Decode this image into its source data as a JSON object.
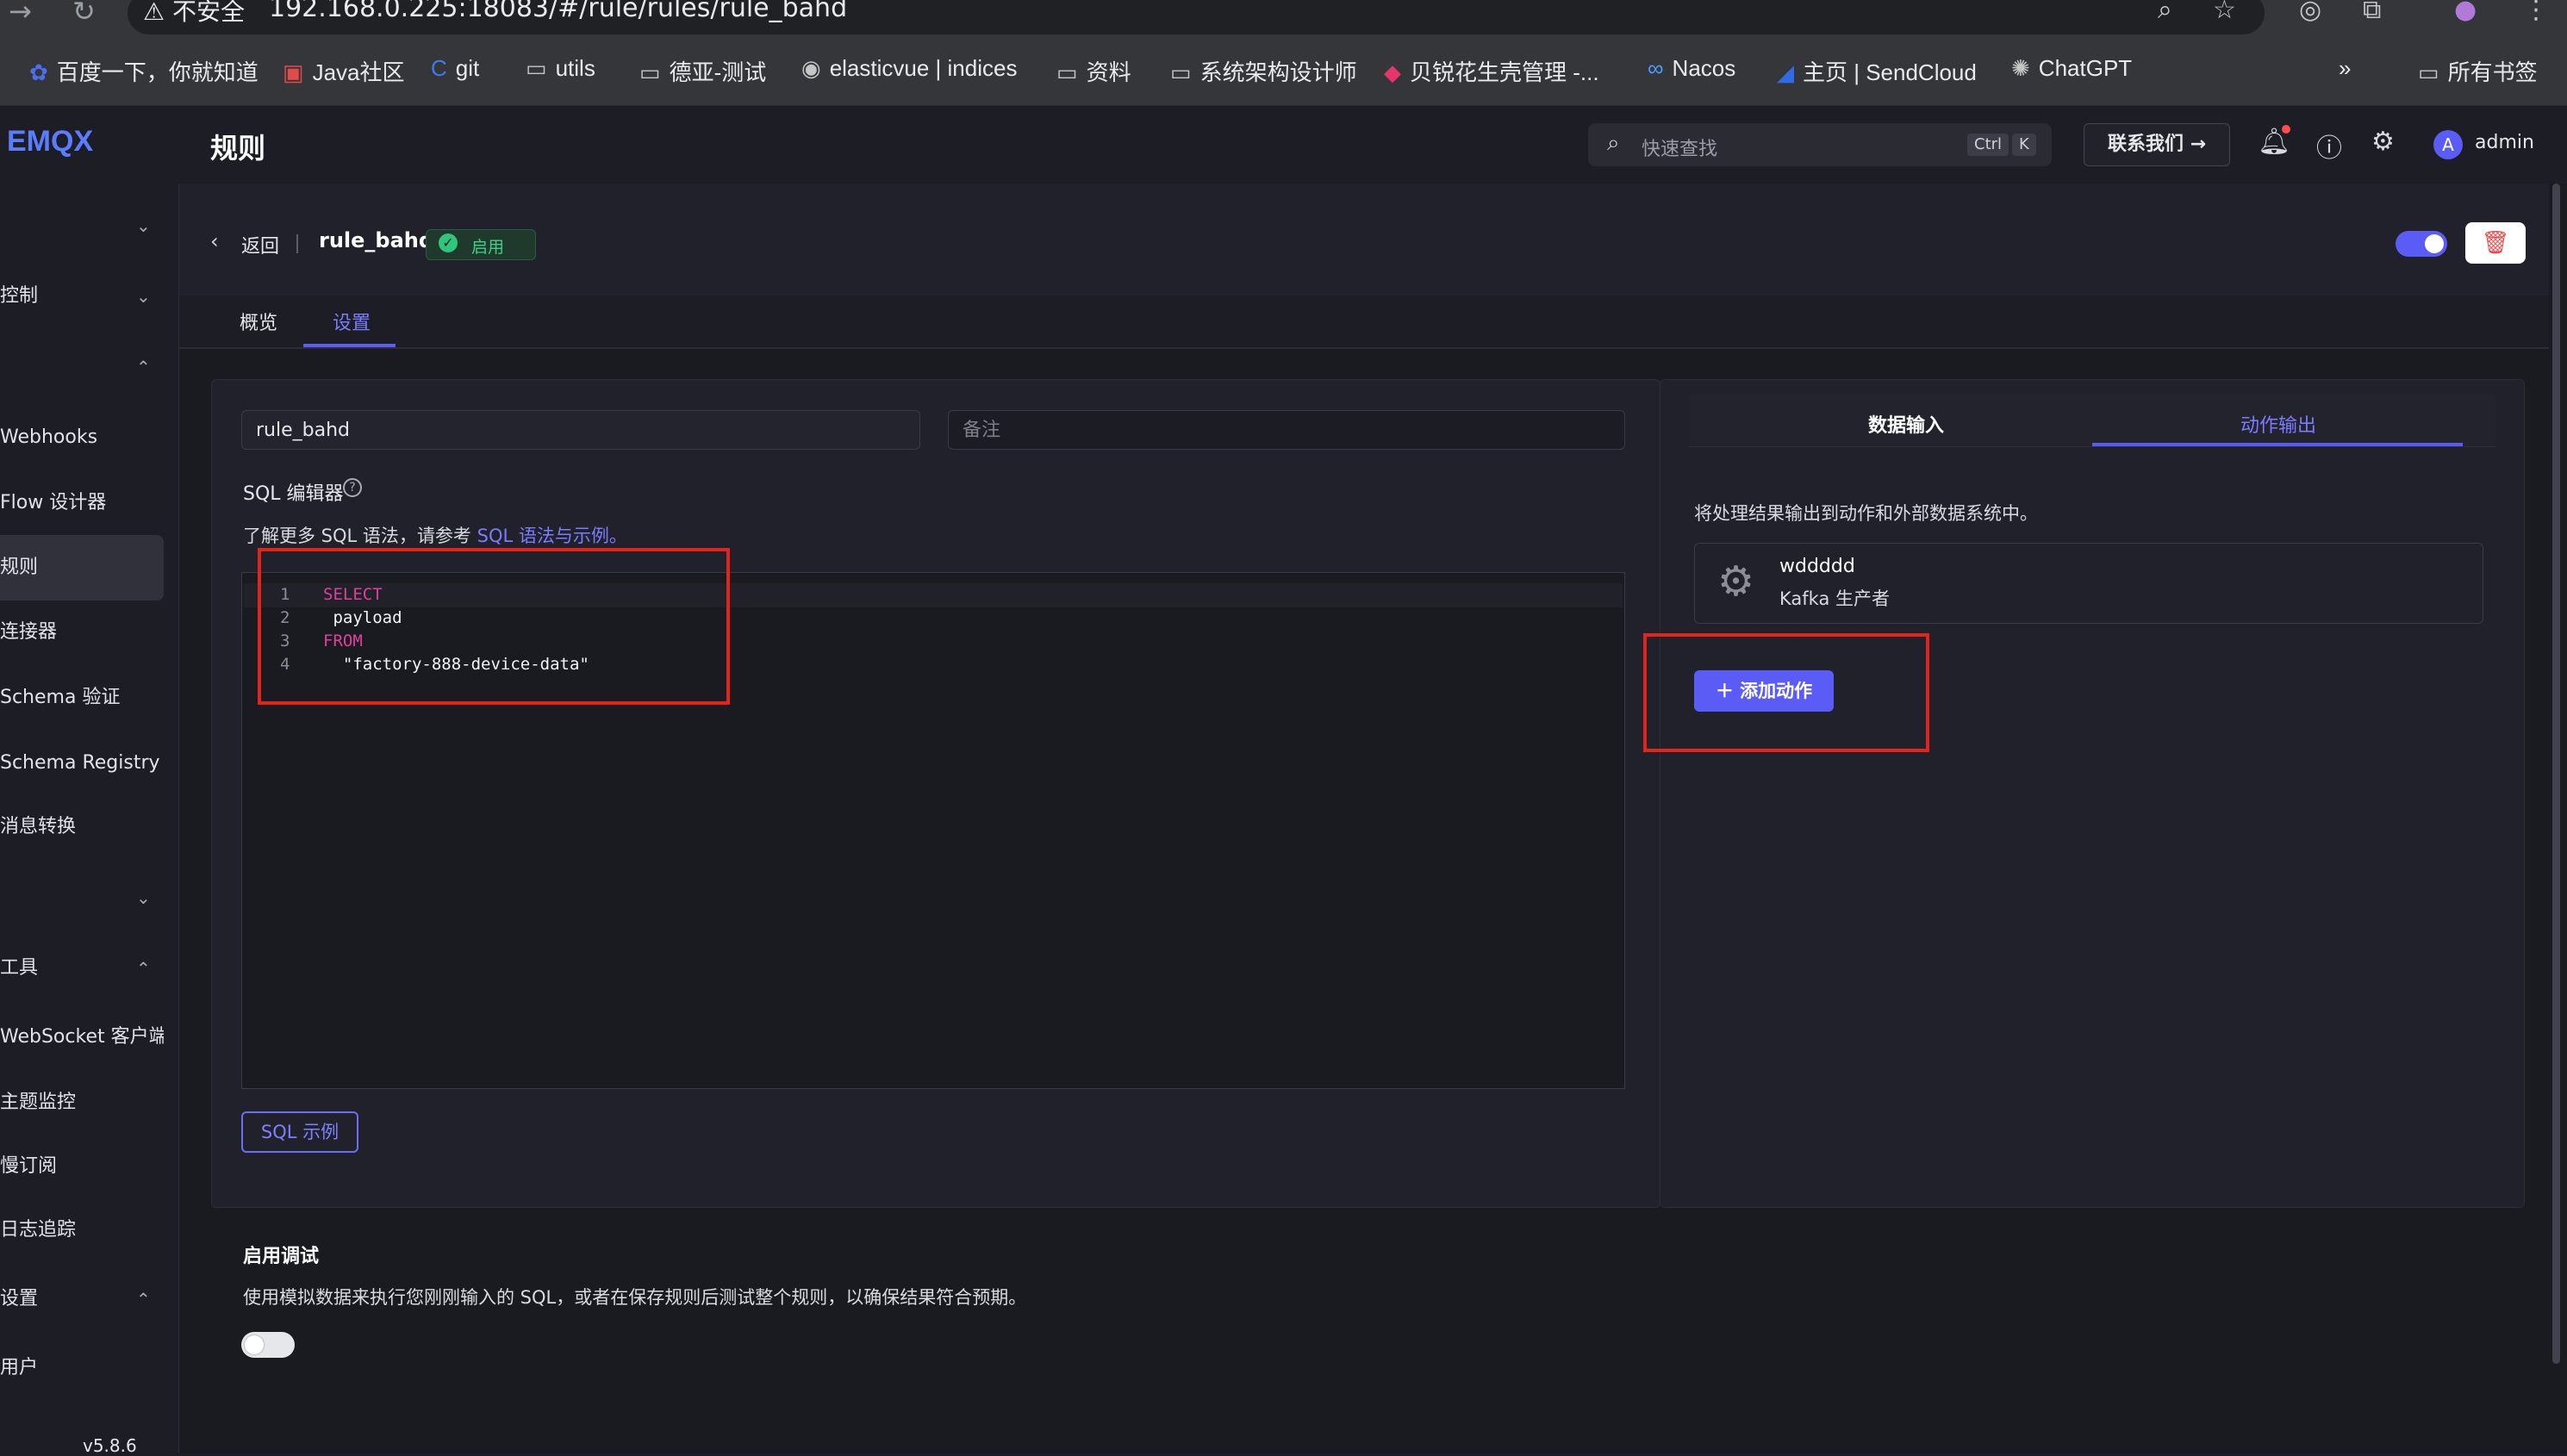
{
  "browser": {
    "security": "⚠ 不安全",
    "url": "192.168.0.225:18083/#/rule/rules/rule_bahd",
    "bookmarks": [
      "百度一下，你就知道",
      "Java社区",
      "git",
      "utils",
      "德亚-测试",
      "elasticvue | indices",
      "资料",
      "系统架构设计师",
      "贝锐花生壳管理 -...",
      "Nacos",
      "主页 | SendCloud",
      "ChatGPT"
    ],
    "all_bookmarks": "所有书签"
  },
  "header": {
    "logo": "EMQX",
    "title": "规则",
    "search_placeholder": "快速查找",
    "shortcut_ctrl": "Ctrl",
    "shortcut_k": "K",
    "contact": "联系我们",
    "avatar": "A",
    "user": "admin"
  },
  "sidebar": {
    "items": [
      "",
      "控制",
      "",
      "Webhooks",
      "Flow 设计器",
      "规则",
      "连接器",
      "Schema 验证",
      "Schema Registry",
      "消息转换",
      "",
      "工具",
      "WebSocket 客户端",
      "主题监控",
      "慢订阅",
      "日志追踪",
      "设置",
      "用户"
    ],
    "version": "v5.8.6"
  },
  "rule": {
    "back": "返回",
    "name": "rule_bahd",
    "status": "启用"
  },
  "tabs": {
    "overview": "概览",
    "settings": "设置"
  },
  "form": {
    "name_value": "rule_bahd",
    "note_placeholder": "备注",
    "sql_label": "SQL 编辑器",
    "hint_prefix": "了解更多 SQL 语法，请参考",
    "hint_link": "SQL 语法与示例。",
    "sql_example_button": "SQL 示例"
  },
  "sql_lines": [
    {
      "num": "1",
      "text": "SELECT"
    },
    {
      "num": "2",
      "text": " payload"
    },
    {
      "num": "3",
      "text": "FROM"
    },
    {
      "num": "4",
      "text": "  \"factory-888-device-data\""
    }
  ],
  "debug": {
    "title": "启用调试",
    "desc": "使用模拟数据来执行您刚刚输入的 SQL，或者在保存规则后测试整个规则，以确保结果符合预期。"
  },
  "right_panel": {
    "tab_input": "数据输入",
    "tab_output": "动作输出",
    "desc": "将处理结果输出到动作和外部数据系统中。",
    "action_name": "wddddd",
    "action_type": "Kafka 生产者",
    "add_action": "添加动作"
  },
  "colors": {
    "accent": "#5b5cf6",
    "highlight_box": "#e3241b",
    "success": "#3fd18a"
  }
}
